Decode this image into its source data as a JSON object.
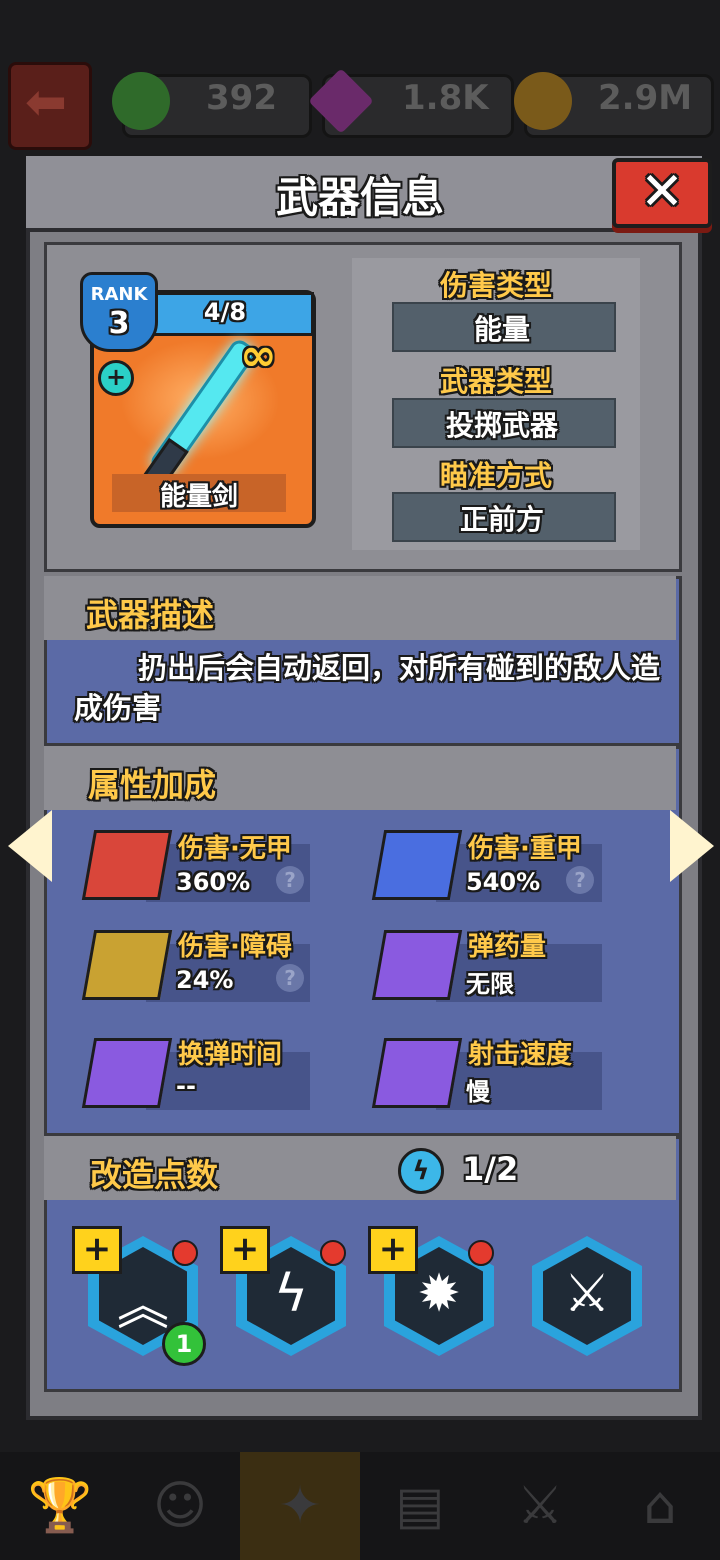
{
  "resources": [
    {
      "name": "green-gem",
      "value": "392",
      "color": "#2f6a2a"
    },
    {
      "name": "purple-gem",
      "value": "1.8K",
      "color": "#6a2a6a"
    },
    {
      "name": "gold-coin",
      "value": "2.9M",
      "color": "#7a5a1a"
    }
  ],
  "modal": {
    "title": "武器信息",
    "close_icon": "✕"
  },
  "weapon": {
    "rank_label": "RANK",
    "rank": "3",
    "level": "4/8",
    "name": "能量剑",
    "infinity": "∞",
    "plus": "+"
  },
  "stats": [
    {
      "label": "伤害类型",
      "value": "能量"
    },
    {
      "label": "武器类型",
      "value": "投掷武器"
    },
    {
      "label": "瞄准方式",
      "value": "正前方"
    }
  ],
  "description": {
    "title": "武器描述",
    "text": "扔出后会自动返回，对所有碰到的敌人造成伤害"
  },
  "attributes": {
    "title": "属性加成",
    "items": [
      {
        "name": "伤害·无甲",
        "value": "360%",
        "help": "?",
        "icon": "target-unarmored-icon",
        "color": "#d9463a"
      },
      {
        "name": "伤害·重甲",
        "value": "540%",
        "help": "?",
        "icon": "target-armored-icon",
        "color": "#4a6ee0"
      },
      {
        "name": "伤害·障碍",
        "value": "24%",
        "help": "?",
        "icon": "target-obstacle-icon",
        "color": "#c9a232"
      },
      {
        "name": "弹药量",
        "value": "无限",
        "icon": "ammo-icon",
        "color": "#8a5ae0"
      },
      {
        "name": "换弹时间",
        "value": "--",
        "icon": "reload-icon",
        "color": "#8a5ae0"
      },
      {
        "name": "射击速度",
        "value": "慢",
        "icon": "fire-rate-icon",
        "color": "#8a5ae0"
      }
    ]
  },
  "mods": {
    "title": "改造点数",
    "points": "1/2",
    "bolt": "ϟ",
    "plus": "+",
    "badge": "1",
    "slots": [
      {
        "icon": "chevron-rank-icon",
        "symbol": "︽"
      },
      {
        "icon": "lightning-icon",
        "symbol": "ϟ"
      },
      {
        "icon": "explosion-icon",
        "symbol": "✹"
      },
      {
        "icon": "winged-blade-icon",
        "symbol": "⚔"
      }
    ]
  },
  "nav": [
    {
      "icon": "trophy-icon",
      "symbol": "🏆"
    },
    {
      "icon": "heroes-icon",
      "symbol": "☺"
    },
    {
      "icon": "gun-icon",
      "symbol": "✦"
    },
    {
      "icon": "book-icon",
      "symbol": "▤"
    },
    {
      "icon": "crossed-swords-icon",
      "symbol": "⚔"
    },
    {
      "icon": "shop-icon",
      "symbol": "⌂"
    }
  ]
}
